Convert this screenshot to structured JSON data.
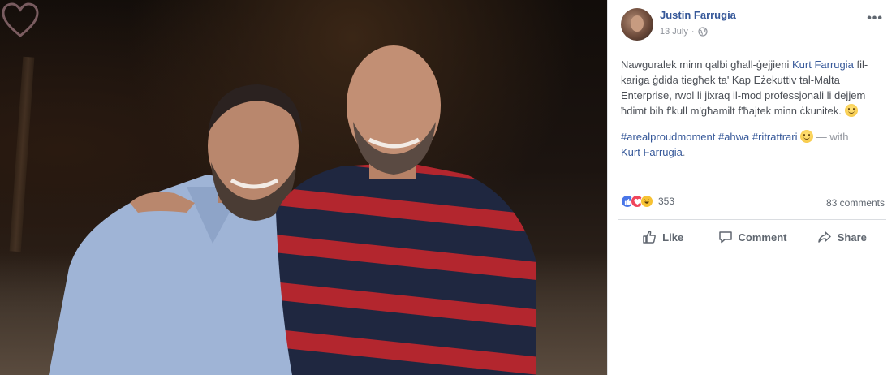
{
  "post": {
    "author": "Justin Farrugia",
    "date": "13 July",
    "separator": "·",
    "more": "•••",
    "text_parts": {
      "p1": "Nawguralek minn qalbi għall-ġejjieni ",
      "mention1": "Kurt Farrugia",
      "p2": " fil-kariga ġdida tiegħek ta' Kap Eżekuttiv tal-Malta Enterprise, rwol li jixraq il-mod professjonali li dejjem ħdimt bih f'kull m'għamilt f'ħajtek minn ċkunitek. "
    },
    "hashtags_line": {
      "tags": "#arealproudmoment #ahwa #ritrattrari",
      "with_text": " — with",
      "mention2": "Kurt Farrugia",
      "end": "."
    },
    "reactions": {
      "count": "353",
      "types": [
        "like-icon",
        "love-icon",
        "haha-icon"
      ]
    },
    "comments_label": "83 comments",
    "actions": {
      "like": "Like",
      "comment": "Comment",
      "share": "Share"
    }
  },
  "colors": {
    "link": "#365899",
    "text": "#4b4f56",
    "muted": "#90949c",
    "like": "#4a76e8",
    "love": "#f0455b",
    "haha": "#f7c233"
  }
}
